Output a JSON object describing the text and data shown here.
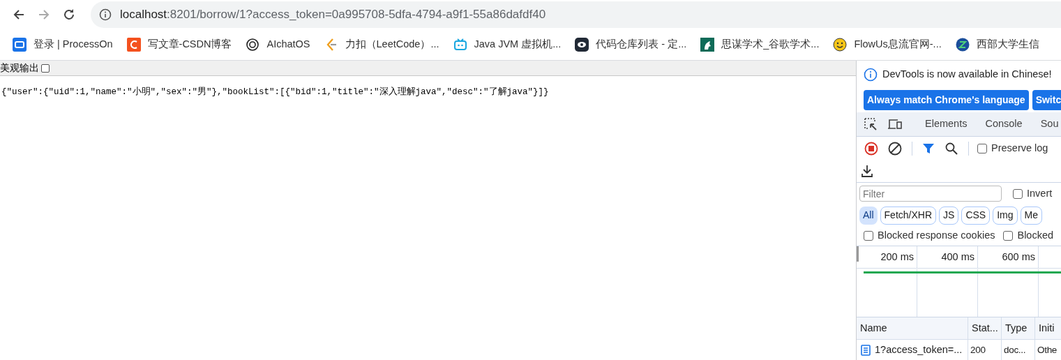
{
  "browser": {
    "address": {
      "host": "localhost",
      "rest": ":8201/borrow/1?access_token=0a995708-5dfa-4794-a9f1-55a86dafdf40"
    },
    "bookmarks": [
      {
        "label": "登录 | ProcessOn"
      },
      {
        "label": "写文章-CSDN博客"
      },
      {
        "label": "AIchatOS"
      },
      {
        "label": "力扣（LeetCode）..."
      },
      {
        "label": "Java JVM 虚拟机..."
      },
      {
        "label": "代码仓库列表 - 定..."
      },
      {
        "label": "思谋学术_谷歌学术..."
      },
      {
        "label": "FlowUs息流官网-..."
      },
      {
        "label": "西部大学生信"
      }
    ]
  },
  "page": {
    "pretty_print": {
      "label": "美观输出",
      "checked": false
    },
    "json_text": "{\"user\":{\"uid\":1,\"name\":\"小明\",\"sex\":\"男\"},\"bookList\":[{\"bid\":1,\"title\":\"深入理解java\",\"desc\":\"了解java\"}]}"
  },
  "devtools": {
    "notice": "DevTools is now available in Chinese!",
    "notice_buttons": [
      "Always match Chrome's language",
      "Switc"
    ],
    "tabs": [
      {
        "label": "Elements",
        "selected": false
      },
      {
        "label": "Console",
        "selected": false
      },
      {
        "label": "Sou",
        "selected": false
      }
    ],
    "recording": true,
    "preserve_log": {
      "label": "Preserve log",
      "checked": false
    },
    "filter": {
      "placeholder": "Filter"
    },
    "invert": {
      "label": "Invert",
      "checked": false
    },
    "type_filters": [
      {
        "label": "All",
        "selected": true
      },
      {
        "label": "Fetch/XHR",
        "selected": false
      },
      {
        "label": "JS",
        "selected": false
      },
      {
        "label": "CSS",
        "selected": false
      },
      {
        "label": "Img",
        "selected": false
      },
      {
        "label": "Me",
        "selected": false
      }
    ],
    "blocked_filters": [
      {
        "label": "Blocked response cookies",
        "checked": false
      },
      {
        "label": "Blocked",
        "checked": false
      }
    ],
    "timeline_ticks": [
      "200 ms",
      "400 ms",
      "600 ms"
    ],
    "columns": [
      "Name",
      "Stat...",
      "Type",
      "Initi"
    ],
    "rows": [
      {
        "name": "1?access_token=...",
        "status": "200",
        "type": "doc...",
        "initiator": "Othe"
      }
    ]
  }
}
